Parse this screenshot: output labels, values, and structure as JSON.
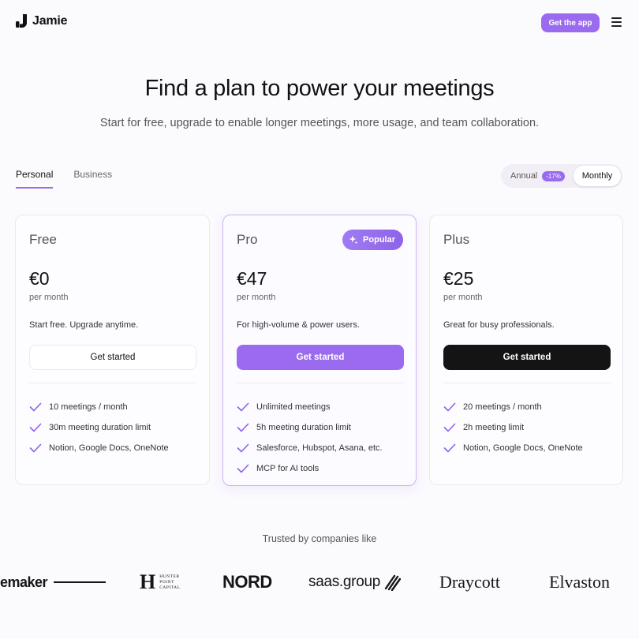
{
  "header": {
    "brand": "Jamie",
    "cta_label": "Get the app"
  },
  "hero": {
    "title": "Find a plan to power your meetings",
    "subtitle": "Start for free, upgrade to enable longer meetings, more usage, and team collaboration."
  },
  "tabs": [
    {
      "label": "Personal",
      "active": true
    },
    {
      "label": "Business",
      "active": false
    }
  ],
  "billing": {
    "annual_label": "Annual",
    "annual_badge": "-17%",
    "monthly_label": "Monthly",
    "selected": "Monthly"
  },
  "plans": [
    {
      "name": "Free",
      "price": "€0",
      "period": "per month",
      "description": "Start free. Upgrade anytime.",
      "cta": "Get started",
      "features": [
        "10 meetings / month",
        "30m meeting duration limit",
        "Notion, Google Docs, OneNote"
      ]
    },
    {
      "name": "Pro",
      "badge": "Popular",
      "price": "€47",
      "period": "per month",
      "description": "For high-volume & power users.",
      "cta": "Get started",
      "features": [
        "Unlimited meetings",
        "5h meeting duration limit",
        "Salesforce, Hubspot, Asana, etc.",
        "MCP for AI tools"
      ]
    },
    {
      "name": "Plus",
      "price": "€25",
      "period": "per month",
      "description": "Great for busy professionals.",
      "cta": "Get started",
      "features": [
        "20 meetings / month",
        "2h meeting limit",
        "Notion, Google Docs, OneNote"
      ]
    }
  ],
  "trusted": {
    "title": "Trusted by companies like",
    "logos": {
      "emaker": "emaker",
      "hunter_mark": "H",
      "hunter_line1": "HUNTER",
      "hunter_line2": "POINT",
      "hunter_line3": "CAPITAL",
      "nord": "NORD",
      "saas": "saas.group",
      "draycott": "Draycott",
      "elvaston": "Elvaston"
    }
  },
  "colors": {
    "accent": "#9b6bef",
    "dark_button": "#141414",
    "background": "#fbfafd"
  }
}
